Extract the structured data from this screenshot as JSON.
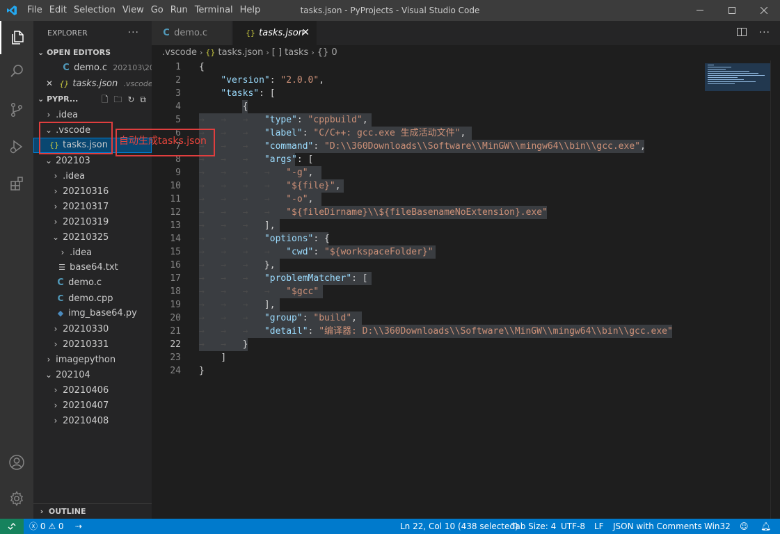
{
  "window": {
    "title": "tasks.json - PyProjects - Visual Studio Code",
    "menu": [
      "File",
      "Edit",
      "Selection",
      "View",
      "Go",
      "Run",
      "Terminal",
      "Help"
    ]
  },
  "explorer": {
    "title": "EXPLORER",
    "more": "···",
    "open_editors_label": "OPEN EDITORS",
    "open_editors": [
      {
        "name": "demo.c",
        "desc": "202103\\20...",
        "icon": "C"
      },
      {
        "name": "tasks.json",
        "desc": ".vscode",
        "icon": "{}"
      }
    ],
    "project_label": "PYPR...",
    "tree": [
      {
        "label": ".idea"
      },
      {
        "label": ".vscode"
      },
      {
        "label": "tasks.json"
      },
      {
        "label": "202103"
      },
      {
        "label": ".idea"
      },
      {
        "label": "20210316"
      },
      {
        "label": "20210317"
      },
      {
        "label": "20210319"
      },
      {
        "label": "20210325"
      },
      {
        "label": ".idea"
      },
      {
        "label": "base64.txt"
      },
      {
        "label": "demo.c"
      },
      {
        "label": "demo.cpp"
      },
      {
        "label": "img_base64.py"
      },
      {
        "label": "20210330"
      },
      {
        "label": "20210331"
      },
      {
        "label": "imagepython"
      },
      {
        "label": "202104"
      },
      {
        "label": "20210406"
      },
      {
        "label": "20210407"
      },
      {
        "label": "20210408"
      }
    ],
    "outline_label": "OUTLINE"
  },
  "annotation": "自动生成tasks.json",
  "tabs": [
    {
      "label": "demo.c",
      "icon": "C"
    },
    {
      "label": "tasks.json",
      "icon": "{}",
      "close": "✕"
    }
  ],
  "breadcrumb": [
    ".vscode",
    "tasks.json",
    "[ ] tasks",
    "{} 0"
  ],
  "editor": {
    "line_numbers": [
      "1",
      "2",
      "3",
      "4",
      "5",
      "6",
      "7",
      "8",
      "9",
      "10",
      "11",
      "12",
      "13",
      "14",
      "15",
      "16",
      "17",
      "18",
      "19",
      "20",
      "21",
      "22",
      "23",
      "24"
    ],
    "version_key": "\"version\"",
    "version_val": "\"2.0.0\"",
    "tasks_key": "\"tasks\"",
    "type_key": "\"type\"",
    "type_val": "\"cppbuild\"",
    "label_key": "\"label\"",
    "label_val": "\"C/C++: gcc.exe 生成活动文件\"",
    "command_key": "\"command\"",
    "command_val": "\"D:\\\\360Downloads\\\\Software\\\\MinGW\\\\mingw64\\\\bin\\\\gcc.exe\"",
    "args_key": "\"args\"",
    "arg1": "\"-g\"",
    "arg2": "\"${file}\"",
    "arg3": "\"-o\"",
    "arg4": "\"${fileDirname}\\\\${fileBasenameNoExtension}.exe\"",
    "options_key": "\"options\"",
    "cwd_key": "\"cwd\"",
    "cwd_val": "\"${workspaceFolder}\"",
    "pm_key": "\"problemMatcher\"",
    "pm_val": "\"$gcc\"",
    "group_key": "\"group\"",
    "group_val": "\"build\"",
    "detail_key": "\"detail\"",
    "detail_val": "\"编译器: D:\\\\360Downloads\\\\Software\\\\MinGW\\\\mingw64\\\\bin\\\\gcc.exe\""
  },
  "status": {
    "errors": "0",
    "warnings": "0",
    "position": "Ln 22, Col 10 (438 selected)",
    "tab_size": "Tab Size: 4",
    "encoding": "UTF-8",
    "eol": "LF",
    "language": "JSON with Comments",
    "platform": "Win32"
  }
}
